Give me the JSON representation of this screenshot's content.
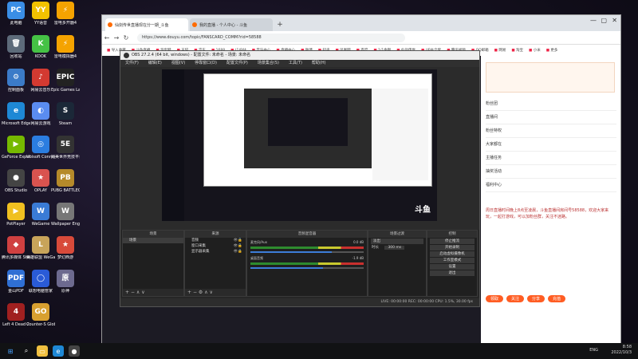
{
  "desktop": {
    "icons": [
      {
        "label": "此电脑",
        "glyph": "PC",
        "color": "#3a8ee6"
      },
      {
        "label": "YY语音",
        "glyph": "YY",
        "color": "#f2c200"
      },
      {
        "label": "雷电多开器4",
        "glyph": "⚡",
        "color": "#f5a300"
      },
      {
        "label": "回收站",
        "glyph": "🗑",
        "color": "#5d6b7a"
      },
      {
        "label": "KOOK",
        "glyph": "K",
        "color": "#45c245"
      },
      {
        "label": "雷电模拟器4",
        "glyph": "⚡",
        "color": "#f5a300"
      },
      {
        "label": "控制面板",
        "glyph": "⚙",
        "color": "#3b7bc8"
      },
      {
        "label": "网易云音乐",
        "glyph": "♪",
        "color": "#d33a31"
      },
      {
        "label": "Epic Games Launcher",
        "glyph": "EPIC",
        "color": "#222"
      },
      {
        "label": "Microsoft Edge",
        "glyph": "e",
        "color": "#1e88d5"
      },
      {
        "label": "网易云游戏",
        "glyph": "◐",
        "color": "#5a8cf0"
      },
      {
        "label": "Steam",
        "glyph": "S",
        "color": "#1b2838"
      },
      {
        "label": "GeForce Experience",
        "glyph": "▶",
        "color": "#76b900"
      },
      {
        "label": "Ubisoft Connect",
        "glyph": "◎",
        "color": "#2b7de0"
      },
      {
        "label": "完美世界竞技平台",
        "glyph": "5E",
        "color": "#333"
      },
      {
        "label": "OBS Studio",
        "glyph": "●",
        "color": "#444"
      },
      {
        "label": "OPLAY",
        "glyph": "★",
        "color": "#d9534f"
      },
      {
        "label": "PUBG BATTLEGR...",
        "glyph": "PB",
        "color": "#b58a2a"
      },
      {
        "label": "PotPlayer",
        "glyph": "▶",
        "color": "#f0c020"
      },
      {
        "label": "WeGame",
        "glyph": "W",
        "color": "#3a7bd5"
      },
      {
        "label": "Wallpaper Engine",
        "glyph": "W",
        "color": "#777"
      },
      {
        "label": "腾讯多媒体 SteamZone",
        "glyph": "◆",
        "color": "#d04040"
      },
      {
        "label": "英雄联盟 WeGame版",
        "glyph": "L",
        "color": "#c8a45a"
      },
      {
        "label": "梦幻西游",
        "glyph": "★",
        "color": "#d84a3a"
      },
      {
        "label": "金山PDF",
        "glyph": "PDF",
        "color": "#2f6fd4"
      },
      {
        "label": "联想电脑管家",
        "glyph": "◯",
        "color": "#2a5bd7"
      },
      {
        "label": "原神",
        "glyph": "原",
        "color": "#6d6a8f"
      },
      {
        "label": "Left 4 Dead 2",
        "glyph": "4",
        "color": "#a02020"
      },
      {
        "label": "Counter-S Global Off",
        "glyph": "GO",
        "color": "#d8a030"
      }
    ]
  },
  "browser": {
    "tabs": [
      {
        "label": "仙剑传世直播现在分一期_斗鱼"
      },
      {
        "label": "我的直播 - 个人中心 - 斗鱼"
      }
    ],
    "url": "https://www.douyu.com/topic/FANSCARD_COMM?rid=58588",
    "bookmarks": [
      "导入收藏",
      "斗鱼直播",
      "淘宝网",
      "天猫",
      "京东",
      "1688",
      "(1)B站",
      "音乐中心",
      "直播中心",
      "微博",
      "知乎",
      "凤凰网",
      "百度",
      "1/1余额",
      "仙剑传世",
      "UP主全套",
      "腾讯视频",
      "QQ邮箱",
      "网易",
      "淘宝",
      "小米",
      "更多"
    ],
    "right_panel": {
      "items": [
        "粉丝团",
        "直播间",
        "粉丝特权",
        "大家都在",
        "主播任务",
        "抽奖活动",
        "福利中心"
      ],
      "chat_text": "周日直播时间晚上8点至凌晨，斗鱼直播间房间号58588，欢迎大家来玩，一起打游戏，可以加粉丝群，关注不迷路。",
      "buttons": [
        "领取",
        "关注",
        "分享",
        "充值"
      ]
    }
  },
  "obs": {
    "title": "OBS 27.2.4 (64 bit, windows) - 配置文件: 未命名 - 场景: 未命名",
    "menu": [
      "文件(F)",
      "编辑(E)",
      "视图(V)",
      "停靠窗口(D)",
      "配置文件(P)",
      "场景集合(S)",
      "工具(T)",
      "帮助(H)"
    ],
    "scenes": {
      "title": "场景",
      "items": [
        "场景"
      ]
    },
    "sources": {
      "title": "来源",
      "items": [
        "音频",
        "窗口采集",
        "显示器采集"
      ]
    },
    "mixer": {
      "title": "音频混音器",
      "channels": [
        {
          "name": "麦克风/Aux",
          "db": "0.0 dB",
          "level": 0.72
        },
        {
          "name": "桌面音频",
          "db": "-1.9 dB",
          "level": 0.64
        }
      ]
    },
    "transitions": {
      "title": "场景过渡",
      "type": "淡出",
      "duration_label": "时长",
      "duration": "300 ms"
    },
    "controls": {
      "title": "控制",
      "buttons": [
        "停止推流",
        "开始录制",
        "启动虚拟摄像机",
        "工作室模式",
        "设置",
        "退出"
      ]
    },
    "status": "LIVE: 00:00:00   REC: 00:00:00   CPU: 1.5%, 30.00 fps"
  },
  "watermark": "斗鱼",
  "taskbar": {
    "lang": "ENG",
    "time": "8:58",
    "date": "2022/10/3"
  }
}
